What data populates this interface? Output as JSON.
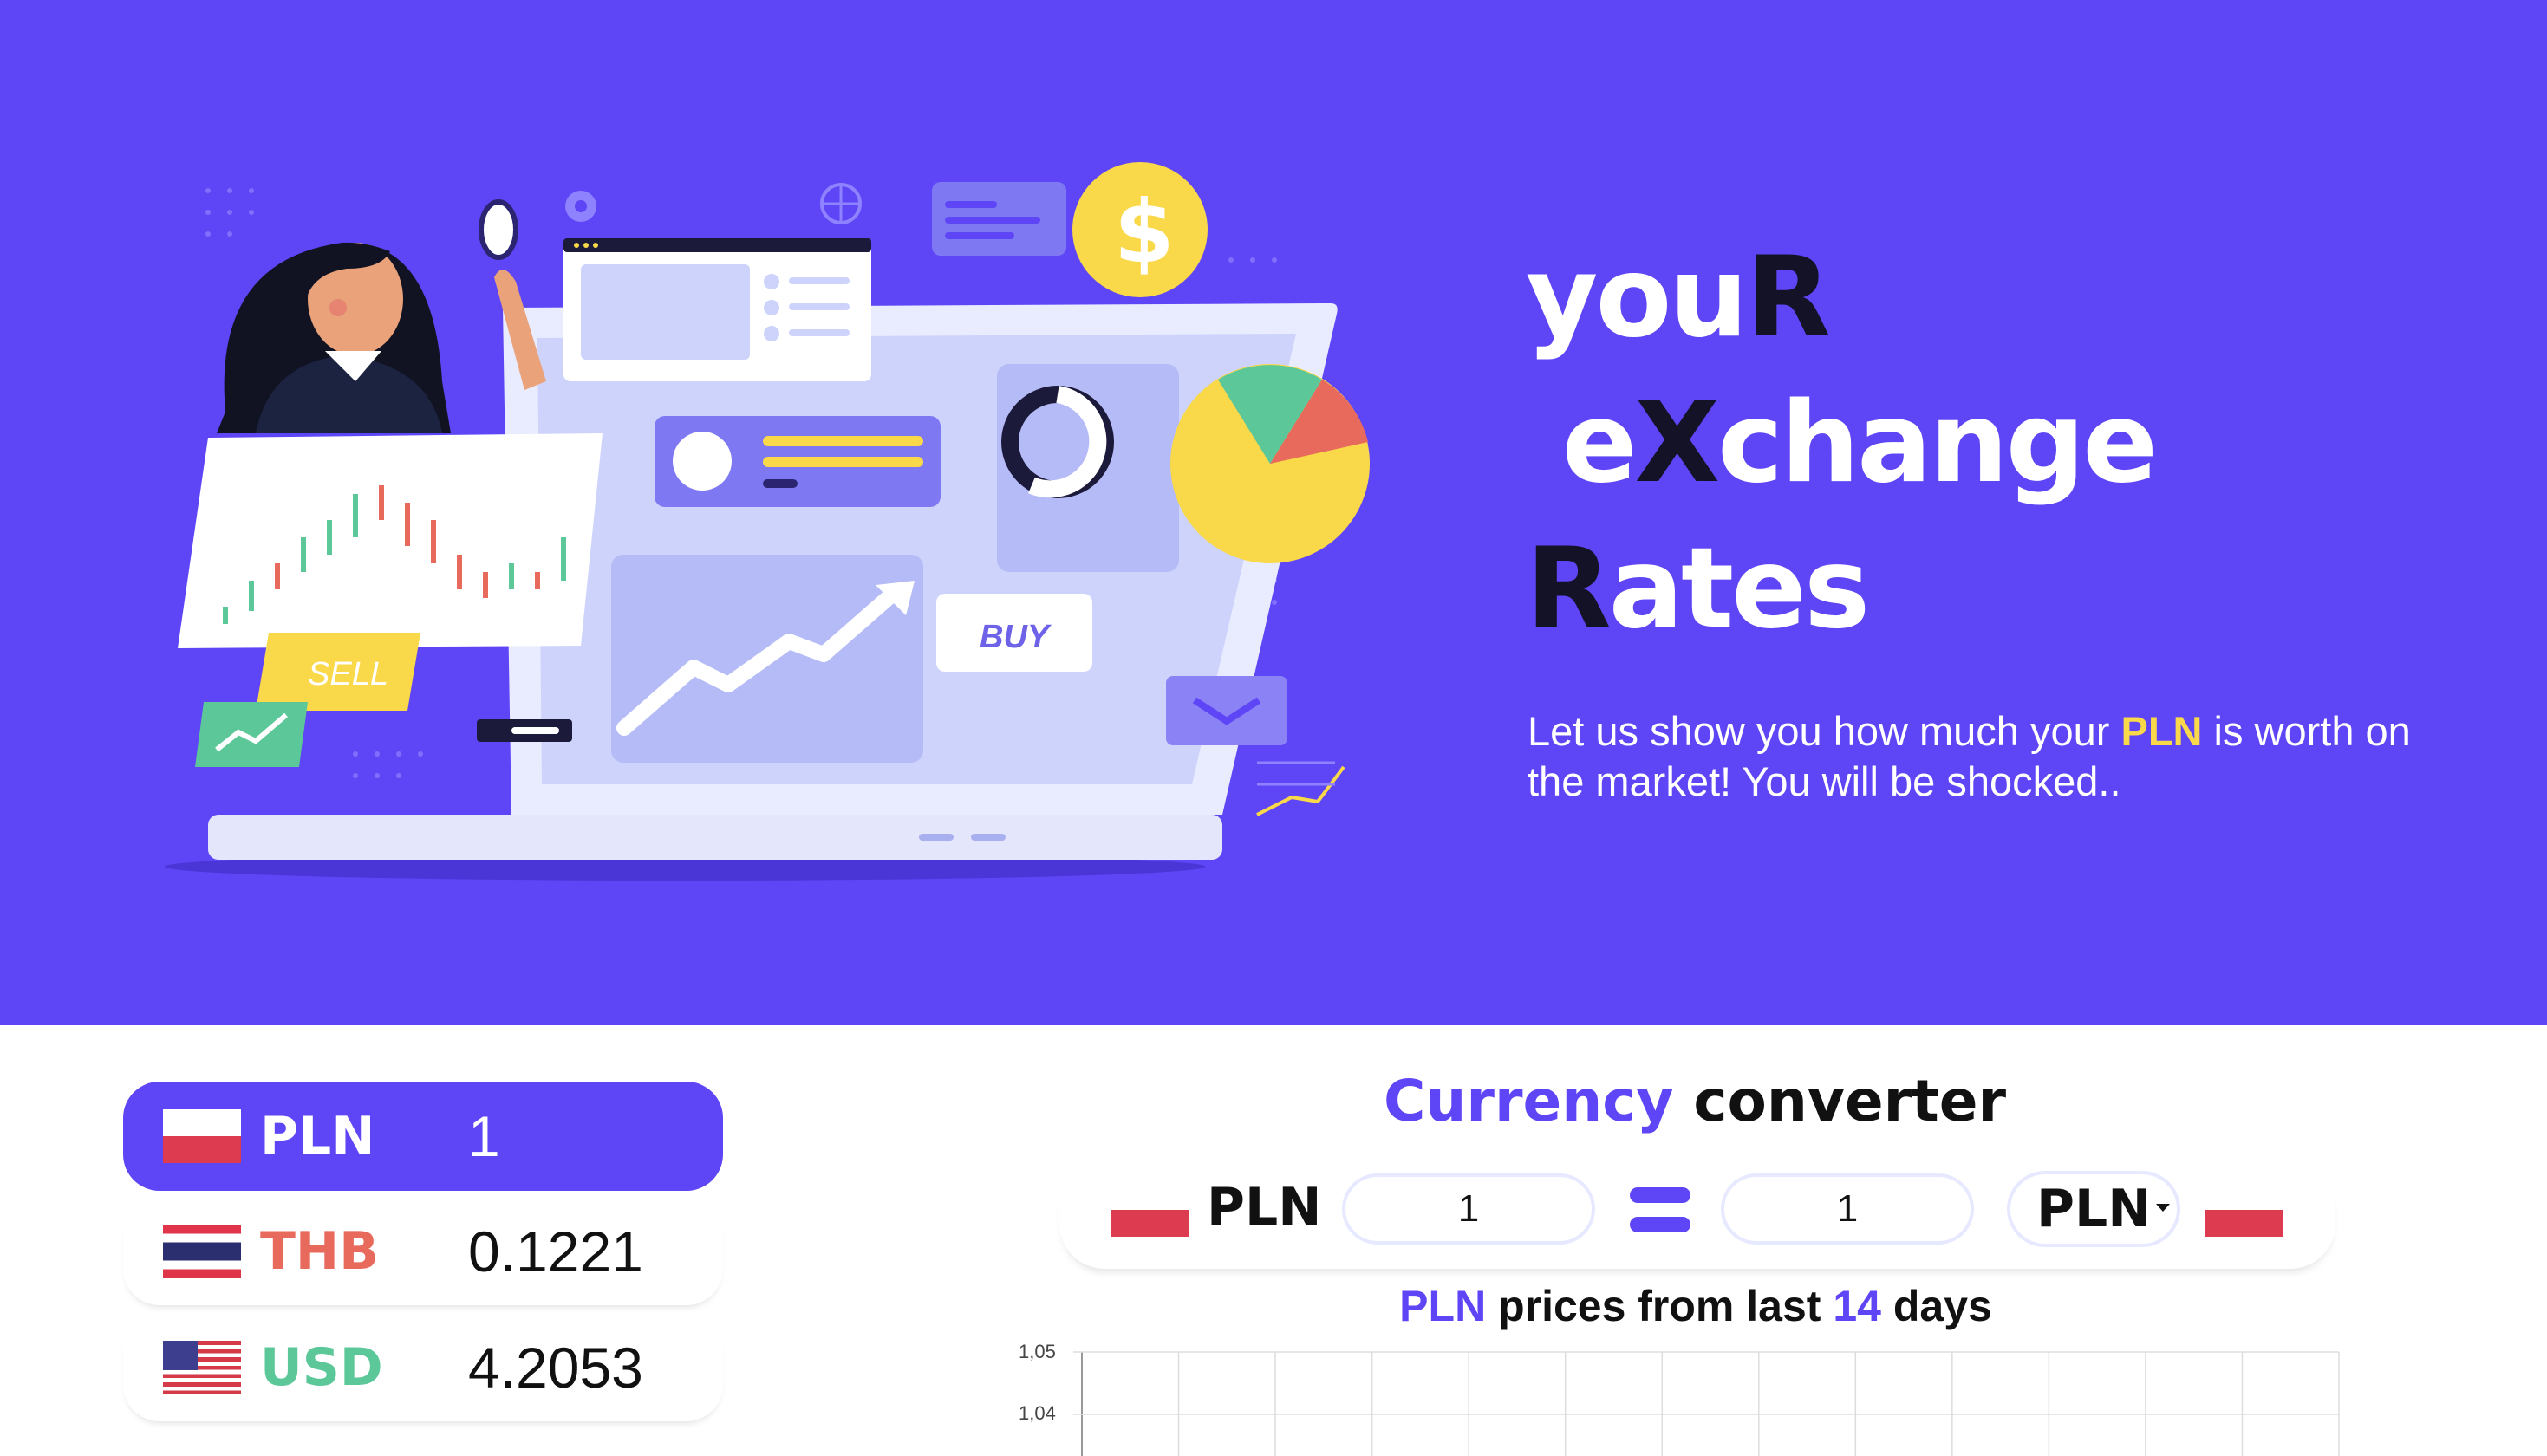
{
  "hero": {
    "title_lines": [
      {
        "a": "you",
        "b": "R",
        "c": ""
      },
      {
        "a": " e",
        "b": "X",
        "c": "change"
      },
      {
        "a": "",
        "b": "R",
        "c": "ates"
      }
    ],
    "subtitle_pre": "Let us show you how much your ",
    "subtitle_highlight": "PLN",
    "subtitle_post": " is worth on the market! You will be shocked..",
    "illustration": {
      "sell_label": "SELL",
      "buy_label": "BUY",
      "dollar_symbol": "$"
    }
  },
  "rates": [
    {
      "flag": "poland-flag",
      "code": "PLN",
      "value": "1",
      "color": "#ffffff",
      "active": true
    },
    {
      "flag": "thailand-flag",
      "code": "THB",
      "value": "0.1221",
      "color": "#e86a5c",
      "active": false
    },
    {
      "flag": "usa-flag",
      "code": "USD",
      "value": "4.2053",
      "color": "#5cc89a",
      "active": false
    }
  ],
  "converter": {
    "title_accent": "Currency",
    "title_rest": " converter",
    "from_code": "PLN",
    "from_value": "1",
    "to_value": "1",
    "to_code": "PLN"
  },
  "chart_title": {
    "code": "PLN",
    "middle": " prices from last ",
    "days": "14",
    "end": " days"
  },
  "chart_data": {
    "type": "line",
    "y_ticks": [
      "1,05",
      "1,04"
    ],
    "ylim": [
      1.04,
      1.05
    ],
    "grid": true,
    "series": []
  },
  "colors": {
    "brand": "#5e45f5",
    "highlight": "#f9d84a",
    "dark": "#141226",
    "thb": "#e86a5c",
    "usd": "#5cc89a"
  }
}
